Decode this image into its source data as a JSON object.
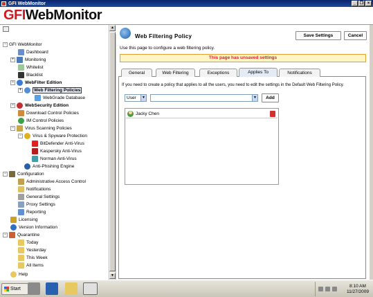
{
  "window": {
    "title": "GFI WebMonitor"
  },
  "header": {
    "logo_prefix": "GFI",
    "logo_suffix": "WebMonitor"
  },
  "sidebar": {
    "items": [
      {
        "label": "GFI WebMonitor",
        "icon": "home-icon"
      },
      {
        "label": "Dashboard",
        "icon": "dashboard-icon"
      },
      {
        "label": "Monitoring",
        "icon": "monitor-icon"
      },
      {
        "label": "Whitelist",
        "icon": "whitelist-icon"
      },
      {
        "label": "Blacklist",
        "icon": "blacklist-icon"
      },
      {
        "label": "WebFilter Edition",
        "icon": "webfilter-icon"
      },
      {
        "label": "Web Filtering Policies",
        "icon": "globe-icon"
      },
      {
        "label": "WebGrade Database",
        "icon": "database-icon"
      },
      {
        "label": "WebSecurity Edition",
        "icon": "websecurity-icon"
      },
      {
        "label": "Download Control Policies",
        "icon": "download-icon"
      },
      {
        "label": "IM Control Policies",
        "icon": "im-icon"
      },
      {
        "label": "Virus Scanning Policies",
        "icon": "virus-icon"
      },
      {
        "label": "Virus & Spyware Protection",
        "icon": "biohazard-icon"
      },
      {
        "label": "BitDefender Anti-Virus",
        "icon": "bitdefender-icon"
      },
      {
        "label": "Kaspersky Anti-Virus",
        "icon": "kaspersky-icon"
      },
      {
        "label": "Norman Anti-Virus",
        "icon": "norman-icon"
      },
      {
        "label": "Anti-Phishing Engine",
        "icon": "phishing-icon"
      },
      {
        "label": "Configuration",
        "icon": "configuration-icon"
      },
      {
        "label": "Administrative Access Control",
        "icon": "admin-icon"
      },
      {
        "label": "Notifications",
        "icon": "notification-icon"
      },
      {
        "label": "General Settings",
        "icon": "settings-icon"
      },
      {
        "label": "Proxy Settings",
        "icon": "proxy-icon"
      },
      {
        "label": "Reporting",
        "icon": "report-icon"
      },
      {
        "label": "Licensing",
        "icon": "key-icon"
      },
      {
        "label": "Version Information",
        "icon": "info-icon"
      },
      {
        "label": "Quarantine",
        "icon": "quarantine-icon"
      },
      {
        "label": "Today",
        "icon": "folder-icon"
      },
      {
        "label": "Yesterday",
        "icon": "folder-icon"
      },
      {
        "label": "This Week",
        "icon": "folder-icon"
      },
      {
        "label": "All Items",
        "icon": "folder-icon"
      },
      {
        "label": "Help",
        "icon": "help-icon"
      }
    ]
  },
  "main": {
    "title": "Web Filtering Policy",
    "save_label": "Save Settings",
    "cancel_label": "Cancel",
    "description": "Use this page to configure a web filtering policy.",
    "warning": "This page has unsaved settings",
    "tabs": [
      {
        "label": "General"
      },
      {
        "label": "Web Filtering"
      },
      {
        "label": "Exceptions"
      },
      {
        "label": "Applies To",
        "active": true
      },
      {
        "label": "Notifications"
      }
    ],
    "applies_to": {
      "info": "If you need to create a policy that applies to all the users, you need to edit the settings in the Default Web Filtering Policy.",
      "type_select": "User",
      "name_select": "",
      "add_label": "Add",
      "entries": [
        {
          "name": "Jacky Chen"
        }
      ]
    }
  },
  "taskbar": {
    "start_label": "Start",
    "time": "8:10 AM",
    "date": "11/27/2009"
  },
  "colors": {
    "warning_text": "#d62020",
    "warning_bg": "#fff4c4",
    "logo_red": "#d01820"
  }
}
